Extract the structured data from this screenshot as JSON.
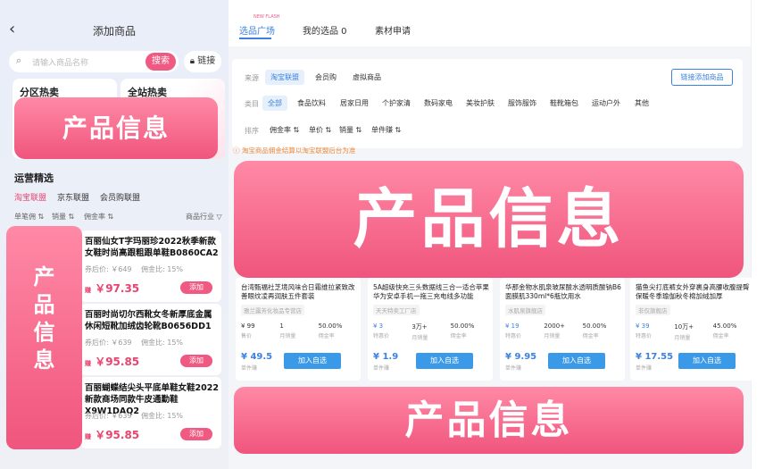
{
  "left": {
    "title": "添加商品",
    "search_placeholder": "请输入商品名称",
    "search_button": "搜索",
    "link_button": "链接",
    "hot": [
      "分区热卖",
      "全站热卖"
    ],
    "banner_text": "产品信息",
    "ops_title": "运营精选",
    "tabs": [
      "淘宝联盟",
      "京东联盟",
      "会员购联盟"
    ],
    "sorts": [
      "单笔佣 ⇅",
      "销量 ⇅",
      "佣金率 ⇅",
      "商品行业 ▽"
    ],
    "banner_vertical": "产品信息",
    "cards": [
      {
        "title": "百丽仙女T字玛丽珍2022秋季新款女鞋时尚高跟粗跟单鞋B0860CA2",
        "meta": "券后价: ￥649",
        "commission": "佣金比: 15%",
        "price": "￥97.35",
        "add": "添加"
      },
      {
        "title": "百丽时尚切尔西靴女冬新厚底金属休闲短靴加绒齿轮靴B0656DD1",
        "meta": "券后价: ￥639",
        "commission": "佣金比: 15%",
        "price": "￥95.85",
        "add": "添加"
      },
      {
        "title": "百丽蝴蝶结尖头平底单鞋女鞋2022新款商场同款牛皮通勤鞋X9W1DAQ2",
        "meta": "券后价: ￥639",
        "commission": "佣金比: 15%",
        "price": "￥95.85",
        "add": "添加"
      }
    ],
    "price_prefix": "赚"
  },
  "right": {
    "tabs": [
      "选品广场",
      "我的选品 0",
      "素材申请"
    ],
    "tab_badge": "NEW FLASH",
    "source_label": "来源",
    "source_chips": [
      "淘宝联盟",
      "会员购",
      "虚拟商品"
    ],
    "batch_button": "链接添加商品",
    "category_label": "类目",
    "category_chips": [
      "全部",
      "食品饮料",
      "居家日用",
      "个护家清",
      "数码家电",
      "美妆护肤",
      "服饰服饰",
      "鞋靴箱包",
      "运动户外",
      "其他"
    ],
    "sort_label": "排序",
    "sort_chips": [
      "佣金率 ⇅",
      "单价 ⇅",
      "销量 ⇅",
      "单件赚 ⇅"
    ],
    "notice": "ⓘ 淘宝商品佣金结算以淘宝联盟后台为准",
    "banner_big": "产品信息",
    "banner_bottom": "产品信息",
    "products": [
      {
        "title": "台湾甄福社芝境风味合日霜维拉紧致改善眼纹凌再润肤五件套装",
        "shop": "雅兰露芳化妆品专营店",
        "stats": [
          [
            "¥ 99",
            "售价"
          ],
          [
            "1",
            "月销量"
          ],
          [
            "50.00%",
            "佣金率"
          ]
        ],
        "price": "¥ 49.5",
        "price_sub": "单件赚",
        "add": "加入自选"
      },
      {
        "title": "5A超级快充三头数据线三合一适合苹果华为安卓手机一拖三充电线多功能",
        "shop": "天天特卖工厂店",
        "stats": [
          [
            "¥ 3",
            "特惠价"
          ],
          [
            "3万+",
            "月销量"
          ],
          [
            "50.00%",
            "佣金率"
          ]
        ],
        "price": "¥ 1.9",
        "price_sub": "单件赚",
        "add": "加入自选"
      },
      {
        "title": "华那金物水肌泉玻尿酸水透明质酸钠B6面膜肌330ml*6瓶饮用水",
        "shop": "水肌泉旗舰店",
        "stats": [
          [
            "¥ 19",
            "特惠价"
          ],
          [
            "2000+",
            "月销量"
          ],
          [
            "50.00%",
            "佣金率"
          ]
        ],
        "price": "¥ 9.95",
        "price_sub": "单件赚",
        "add": "加入自选"
      },
      {
        "title": "猫鱼尖打底裤女外穿裹身高腰收腹提臀保暖冬季瑜伽秋冬棉加绒加厚",
        "shop": "非仅旗舰店",
        "stats": [
          [
            "¥ 39",
            "特惠价"
          ],
          [
            "10万+",
            "月销量"
          ],
          [
            "45.00%",
            "佣金率"
          ]
        ],
        "price": "¥ 17.55",
        "price_sub": "单件赚",
        "add": "加入自选"
      }
    ]
  },
  "colors": {
    "accent_pink": "#f05a82",
    "accent_blue": "#3b82e0"
  }
}
